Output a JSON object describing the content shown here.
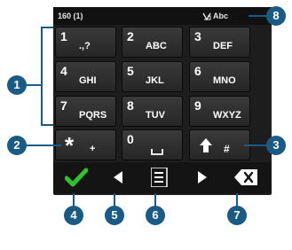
{
  "status_bar": {
    "counter": "160 (1)",
    "input_mode": "Abc"
  },
  "keys": [
    {
      "num": "1",
      "letters": ".,?"
    },
    {
      "num": "2",
      "letters": "ABC"
    },
    {
      "num": "3",
      "letters": "DEF"
    },
    {
      "num": "4",
      "letters": "GHI"
    },
    {
      "num": "5",
      "letters": "JKL"
    },
    {
      "num": "6",
      "letters": "MNO"
    },
    {
      "num": "7",
      "letters": "PQRS"
    },
    {
      "num": "8",
      "letters": "TUV"
    },
    {
      "num": "9",
      "letters": "WXYZ"
    }
  ],
  "bottom_keys": {
    "star": {
      "num": "*",
      "sub": "+"
    },
    "zero": {
      "num": "0",
      "sub": "␣"
    },
    "shift": {
      "sub": "#"
    }
  },
  "toolbar": [
    "checkmark-icon",
    "arrow-left-icon",
    "menu-icon",
    "arrow-right-icon",
    "backspace-icon"
  ],
  "callouts": [
    "1",
    "2",
    "3",
    "4",
    "5",
    "6",
    "7",
    "8"
  ],
  "colors": {
    "callout": "#1a5b86",
    "keyboard": "#1d1d1d",
    "check": "#2fc12f"
  }
}
